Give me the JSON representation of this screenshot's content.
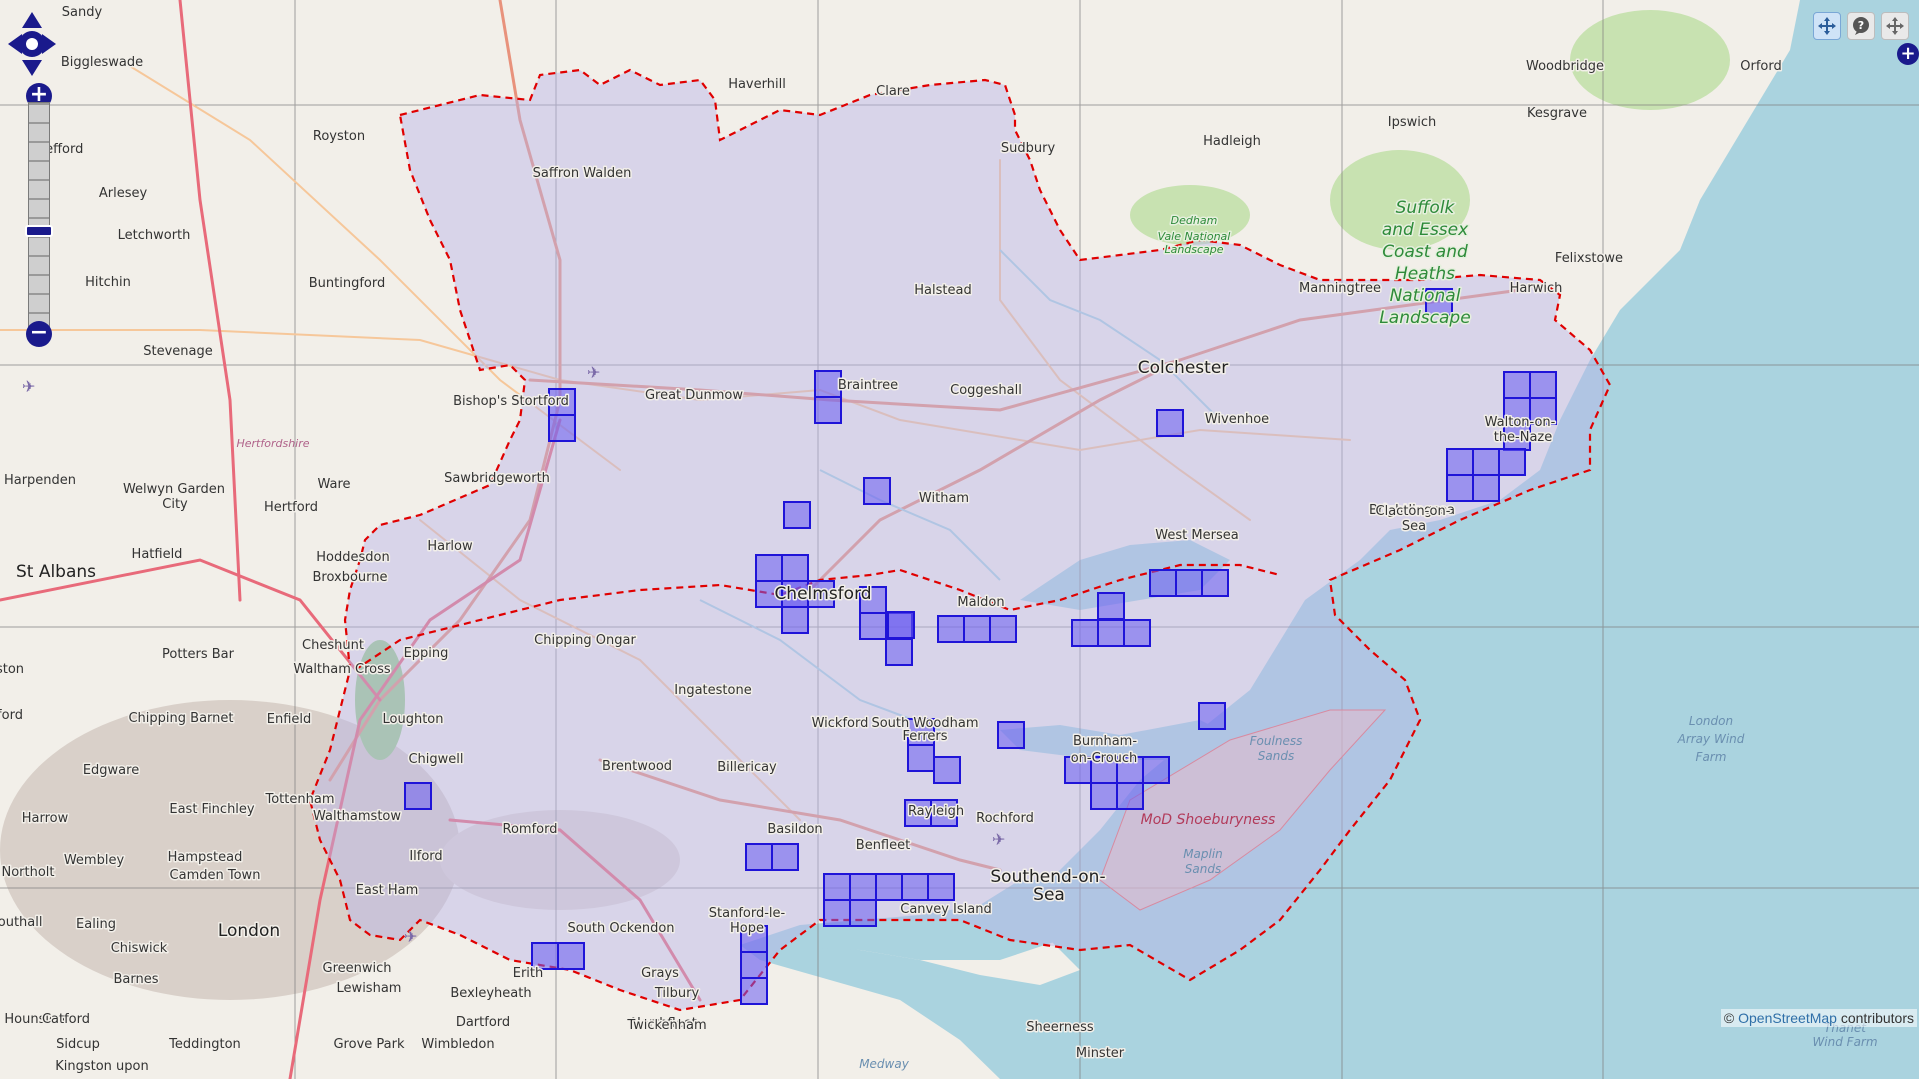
{
  "map": {
    "colors": {
      "land": "#f2efe9",
      "sea": "#aad3df",
      "county_fill": "#b7b4e8",
      "boundary": "#e00000",
      "cells_fill": "#6a5bf2",
      "cells_stroke": "#1f14d8",
      "main_road": "#e8927c",
      "minor_road": "#f6c79a",
      "motorway": "#e86a7a",
      "green": "#c8e2b1",
      "urban": "#d9d0c9"
    },
    "labels": [
      {
        "name": "Sandy",
        "cls": "town"
      },
      {
        "name": "Biggleswade",
        "cls": "town"
      },
      {
        "name": "Royston",
        "cls": "town"
      },
      {
        "name": "Shefford",
        "cls": "town"
      },
      {
        "name": "Arlesey",
        "cls": "town"
      },
      {
        "name": "Letchworth",
        "cls": "town"
      },
      {
        "name": "Hitchin",
        "cls": "town"
      },
      {
        "name": "Stevenage",
        "cls": "town"
      },
      {
        "name": "Buntingford",
        "cls": "town"
      },
      {
        "name": "Saffron Walden",
        "cls": "town"
      },
      {
        "name": "Haverhill",
        "cls": "town"
      },
      {
        "name": "Clare",
        "cls": "town"
      },
      {
        "name": "Sudbury",
        "cls": "town"
      },
      {
        "name": "Hadleigh",
        "cls": "town"
      },
      {
        "name": "Ipswich",
        "cls": "town"
      },
      {
        "name": "Kesgrave",
        "cls": "town"
      },
      {
        "name": "Woodbridge",
        "cls": "town"
      },
      {
        "name": "Orford",
        "cls": "town"
      },
      {
        "name": "Felixstowe",
        "cls": "town"
      },
      {
        "name": "Harwich",
        "cls": "town"
      },
      {
        "name": "Manningtree",
        "cls": "town"
      },
      {
        "name": "Halstead",
        "cls": "town"
      },
      {
        "name": "Braintree",
        "cls": "town"
      },
      {
        "name": "Coggeshall",
        "cls": "town"
      },
      {
        "name": "Great Dunmow",
        "cls": "town"
      },
      {
        "name": "Bishop's Stortford",
        "cls": "town"
      },
      {
        "name": "Colchester",
        "cls": "city"
      },
      {
        "name": "Wivenhoe",
        "cls": "town"
      },
      {
        "name": "Walton-on-",
        "cls": "town"
      },
      {
        "name": "the-Naze",
        "cls": "town"
      },
      {
        "name": "Brightlingsea",
        "cls": "town"
      },
      {
        "name": "Clacton-on-",
        "cls": "town"
      },
      {
        "name": "Sea",
        "cls": "town"
      },
      {
        "name": "West Mersea",
        "cls": "town"
      },
      {
        "name": "Witham",
        "cls": "town"
      },
      {
        "name": "Chelmsford",
        "cls": "city"
      },
      {
        "name": "Maldon",
        "cls": "town"
      },
      {
        "name": "Harpenden",
        "cls": "town"
      },
      {
        "name": "Welwyn Garden",
        "cls": "town"
      },
      {
        "name": "City",
        "cls": "town"
      },
      {
        "name": "Hertford",
        "cls": "town"
      },
      {
        "name": "Ware",
        "cls": "town"
      },
      {
        "name": "Sawbridgeworth",
        "cls": "town"
      },
      {
        "name": "Harlow",
        "cls": "town"
      },
      {
        "name": "St Albans",
        "cls": "city"
      },
      {
        "name": "Hatfield",
        "cls": "town"
      },
      {
        "name": "Hoddesdon",
        "cls": "town"
      },
      {
        "name": "Broxbourne",
        "cls": "town"
      },
      {
        "name": "Cheshunt",
        "cls": "town"
      },
      {
        "name": "Waltham Cross",
        "cls": "town"
      },
      {
        "name": "Epping",
        "cls": "town"
      },
      {
        "name": "Chipping Ongar",
        "cls": "town"
      },
      {
        "name": "Potters Bar",
        "cls": "town"
      },
      {
        "name": "Ingatestone",
        "cls": "town"
      },
      {
        "name": "Loughton",
        "cls": "town"
      },
      {
        "name": "Enfield",
        "cls": "town"
      },
      {
        "name": "Chipping Barnet",
        "cls": "town"
      },
      {
        "name": "Chigwell",
        "cls": "town"
      },
      {
        "name": "Edgware",
        "cls": "town"
      },
      {
        "name": "Billericay",
        "cls": "town"
      },
      {
        "name": "Brentwood",
        "cls": "town"
      },
      {
        "name": "Wickford",
        "cls": "town"
      },
      {
        "name": "South Woodham",
        "cls": "town"
      },
      {
        "name": "Ferrers",
        "cls": "town"
      },
      {
        "name": "Burnham-",
        "cls": "town"
      },
      {
        "name": "on-Crouch",
        "cls": "town"
      },
      {
        "name": "Tottenham",
        "cls": "town"
      },
      {
        "name": "Walthamstow",
        "cls": "town"
      },
      {
        "name": "East Finchley",
        "cls": "town"
      },
      {
        "name": "Harrow",
        "cls": "town"
      },
      {
        "name": "Romford",
        "cls": "town"
      },
      {
        "name": "Rayleigh",
        "cls": "town"
      },
      {
        "name": "Rochford",
        "cls": "town"
      },
      {
        "name": "Basildon",
        "cls": "town"
      },
      {
        "name": "Benfleet",
        "cls": "town"
      },
      {
        "name": "Ilford",
        "cls": "town"
      },
      {
        "name": "Hampstead",
        "cls": "town"
      },
      {
        "name": "Wembley",
        "cls": "town"
      },
      {
        "name": "Camden Town",
        "cls": "town"
      },
      {
        "name": "Northolt",
        "cls": "town"
      },
      {
        "name": "East Ham",
        "cls": "town"
      },
      {
        "name": "Southend-on-",
        "cls": "city"
      },
      {
        "name": "Sea",
        "cls": "city"
      },
      {
        "name": "Canvey Island",
        "cls": "town"
      },
      {
        "name": "Stanford-le-",
        "cls": "town"
      },
      {
        "name": "Hope",
        "cls": "town"
      },
      {
        "name": "South Ockendon",
        "cls": "town"
      },
      {
        "name": "Ealing",
        "cls": "town"
      },
      {
        "name": "London",
        "cls": "city"
      },
      {
        "name": "Chiswick",
        "cls": "town"
      },
      {
        "name": "Greenwich",
        "cls": "town"
      },
      {
        "name": "Erith",
        "cls": "town"
      },
      {
        "name": "Grays",
        "cls": "town"
      },
      {
        "name": "Tilbury",
        "cls": "town"
      },
      {
        "name": "Hounslow",
        "cls": "town"
      },
      {
        "name": "Barnes",
        "cls": "town"
      },
      {
        "name": "Lewisham",
        "cls": "town"
      },
      {
        "name": "Bexleyheath",
        "cls": "town"
      },
      {
        "name": "Dartford",
        "cls": "town"
      },
      {
        "name": "Northfleet",
        "cls": "town"
      },
      {
        "name": "Twickenham",
        "cls": "town"
      },
      {
        "name": "Catford",
        "cls": "town"
      },
      {
        "name": "Teddington",
        "cls": "town"
      },
      {
        "name": "Grove Park",
        "cls": "town"
      },
      {
        "name": "Sidcup",
        "cls": "town"
      },
      {
        "name": "Wimbledon",
        "cls": "town"
      },
      {
        "name": "Kingston upon",
        "cls": "town"
      },
      {
        "name": "Sheerness",
        "cls": "town"
      },
      {
        "name": "Minster",
        "cls": "town"
      },
      {
        "name": "Southall",
        "cls": "town"
      },
      {
        "name": "ston",
        "cls": "town"
      },
      {
        "name": "ford",
        "cls": "town"
      }
    ],
    "green_labels": [
      "Dedham",
      "Vale National",
      "Landscape",
      "Suffolk",
      "and Essex",
      "Coast and",
      "Heaths",
      "National",
      "Landscape"
    ],
    "water_labels": [
      "Foulness",
      "Sands",
      "Maplin",
      "Sands",
      "Medway",
      "London",
      "Array Wind",
      "Farm",
      "Thanet",
      "Wind Farm"
    ],
    "county_label": "Hertfordshire",
    "mod_label": "MoD Shoeburyness"
  },
  "controls": {
    "pan_icon": "pan-arrows-icon",
    "zoom_in": "+",
    "zoom_out": "−",
    "tools": [
      {
        "name": "navigate-tool",
        "icon": "move-icon",
        "active": true
      },
      {
        "name": "query-tool",
        "icon": "question-bubble-icon",
        "active": false
      },
      {
        "name": "pan-tool",
        "icon": "pan-cross-icon",
        "active": false
      }
    ],
    "layer_switcher": "+"
  },
  "attribution": {
    "prefix": "©",
    "link": "OpenStreetMap",
    "suffix": "contributors"
  }
}
